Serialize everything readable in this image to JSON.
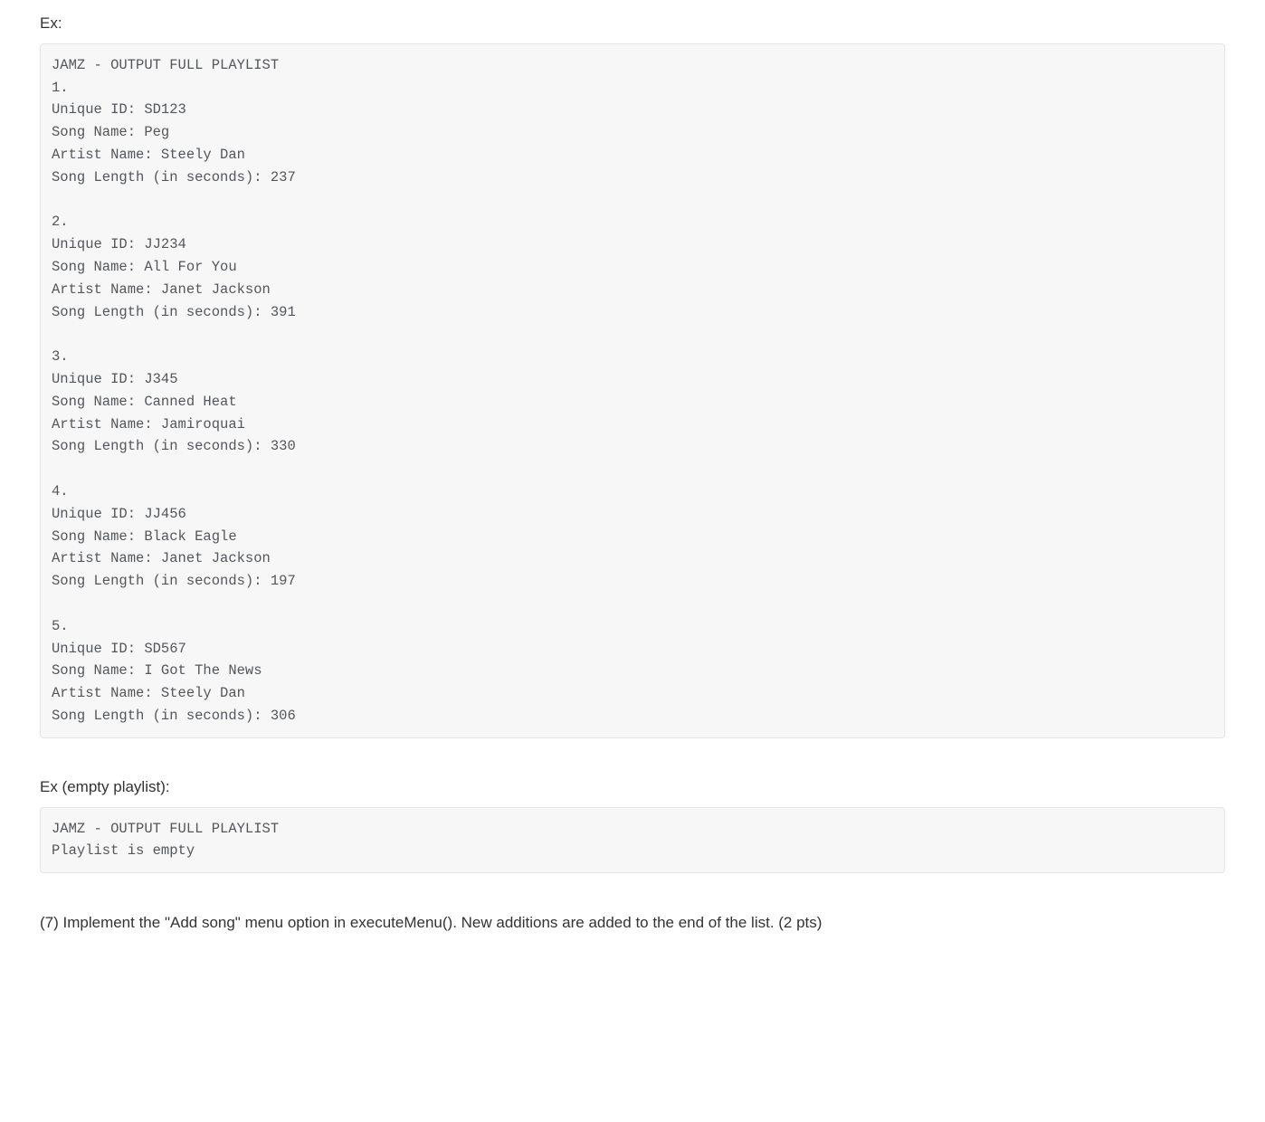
{
  "labels": {
    "ex": "Ex:",
    "ex_empty": "Ex (empty playlist):"
  },
  "question_text": "(7) Implement the \"Add song\" menu option in executeMenu(). New additions are added to the end of the list. (2 pts)",
  "code_block_header": "JAMZ - OUTPUT FULL PLAYLIST",
  "playlist": [
    {
      "n": "1.",
      "unique_id": "Unique ID: SD123",
      "song_name": "Song Name: Peg",
      "artist_name": "Artist Name: Steely Dan",
      "length": "Song Length (in seconds): 237"
    },
    {
      "n": "2.",
      "unique_id": "Unique ID: JJ234",
      "song_name": "Song Name: All For You",
      "artist_name": "Artist Name: Janet Jackson",
      "length": "Song Length (in seconds): 391"
    },
    {
      "n": "3.",
      "unique_id": "Unique ID: J345",
      "song_name": "Song Name: Canned Heat",
      "artist_name": "Artist Name: Jamiroquai",
      "length": "Song Length (in seconds): 330"
    },
    {
      "n": "4.",
      "unique_id": "Unique ID: JJ456",
      "song_name": "Song Name: Black Eagle",
      "artist_name": "Artist Name: Janet Jackson",
      "length": "Song Length (in seconds): 197"
    },
    {
      "n": "5.",
      "unique_id": "Unique ID: SD567",
      "song_name": "Song Name: I Got The News",
      "artist_name": "Artist Name: Steely Dan",
      "length": "Song Length (in seconds): 306"
    }
  ],
  "empty_block": {
    "header": "JAMZ - OUTPUT FULL PLAYLIST",
    "empty_msg": "Playlist is empty"
  }
}
